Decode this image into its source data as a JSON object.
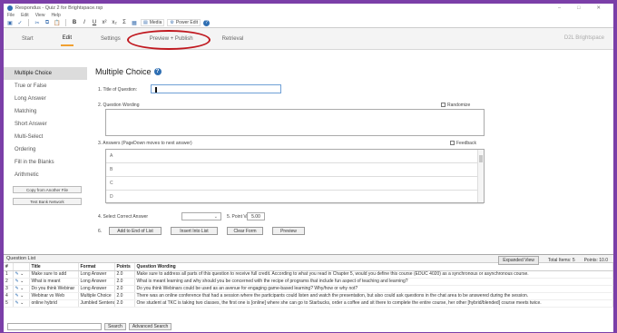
{
  "window": {
    "title": "Respondus - Quiz 2 for Brightspace.rsp",
    "controls": [
      "–",
      "□",
      "✕"
    ]
  },
  "menu": [
    "File",
    "Edit",
    "View",
    "Help"
  ],
  "toolbar": {
    "media_label": "Media",
    "power_edit_label": "Power Edit"
  },
  "tabs": [
    {
      "label": "Start",
      "active": false
    },
    {
      "label": "Edit",
      "active": true
    },
    {
      "label": "Settings",
      "active": false
    },
    {
      "label": "Preview + Publish",
      "active": false
    },
    {
      "label": "Retrieval",
      "active": false
    }
  ],
  "brand": "D2L Brightspace",
  "sidebar": {
    "items": [
      {
        "label": "Multiple Choice",
        "active": true
      },
      {
        "label": "True or False",
        "active": false
      },
      {
        "label": "Long Answer",
        "active": false
      },
      {
        "label": "Matching",
        "active": false
      },
      {
        "label": "Short Answer",
        "active": false
      },
      {
        "label": "Multi-Select",
        "active": false
      },
      {
        "label": "Ordering",
        "active": false
      },
      {
        "label": "Fill in the Blanks",
        "active": false
      },
      {
        "label": "Arithmetic",
        "active": false
      }
    ],
    "copy_button": "Copy from Another File",
    "test_bank_button": "Test Bank Network"
  },
  "editor": {
    "heading": "Multiple Choice",
    "step1": "1.  Title of Question:",
    "title_value": "",
    "step2": "2.  Question Wording",
    "randomize": "Randomize",
    "step3": "3.  Answers (PageDown moves to next answer)",
    "feedback": "Feedback",
    "answer_letters": [
      "A",
      "B",
      "C",
      "D"
    ],
    "step4": "4.  Select Correct Answer",
    "step5": "5.  Point Value",
    "point_value": "5.00",
    "step6": "6.",
    "buttons": {
      "add_end": "Add to End of List",
      "insert": "Insert Into List",
      "clear": "Clear Form",
      "preview": "Preview"
    }
  },
  "question_list": {
    "title": "Question List",
    "expanded_view": "Expanded View",
    "total_items": "Total Items: 5",
    "points": "Points: 10.0",
    "columns": [
      "#",
      "",
      "Title",
      "Format",
      "Points",
      "Question Wording"
    ],
    "rows": [
      {
        "num": "1",
        "title": "Make sure to add",
        "format": "Long Answer",
        "points": "2.0",
        "wording": "Make sure to address all parts of this question to receive full credit. According to what you read in Chapter 5, would you define this course (EDUC 4020) as a synchronous or asynchronous course."
      },
      {
        "num": "2",
        "title": "What is meant",
        "format": "Long Answer",
        "points": "2.0",
        "wording": "What is meant learning and why should you be concerned with the recipe of programs that include fun aspect of teaching and learning?"
      },
      {
        "num": "3",
        "title": "Do you think Webinar",
        "format": "Long Answer",
        "points": "2.0",
        "wording": "Do you think Webinars could be used as an avenue for engaging game-based learning? Why/how or why not?"
      },
      {
        "num": "4",
        "title": "Webinar vs Web",
        "format": "Multiple Choice",
        "points": "2.0",
        "wording": "There was an online conference that had a session where the participants could listen and watch the presentation, but also could ask questions in the chat area to be answered during the session."
      },
      {
        "num": "5",
        "title": "online hybrid",
        "format": "Jumbled Sentence",
        "points": "2.0",
        "wording": "One student at TKC is taking two classes, the first one is [online] where she can go to Starbucks, order a coffee and sit there to complete the entire course, her other [hybrid/blended] course meets twice."
      }
    ],
    "search_button": "Search",
    "advanced_search_button": "Advanced Search"
  }
}
